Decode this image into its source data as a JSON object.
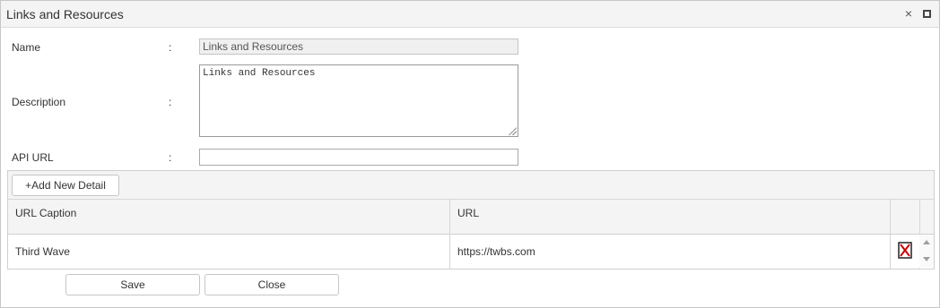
{
  "window": {
    "title": "Links and Resources",
    "close_glyph": "×"
  },
  "form": {
    "name_label": "Name",
    "name_value": "Links and Resources",
    "description_label": "Description",
    "description_value": "Links and Resources",
    "api_url_label": "API URL",
    "api_url_value": "",
    "colon": ":"
  },
  "grid": {
    "add_button_label": "+Add New Detail",
    "columns": [
      "URL Caption",
      "URL"
    ],
    "rows": [
      {
        "caption": "Third Wave",
        "url": "https://twbs.com",
        "delete_icon": "delete-icon"
      }
    ]
  },
  "footer": {
    "save_label": "Save",
    "close_label": "Close"
  },
  "colors": {
    "delete_icon": "#cc0000",
    "header_bg": "#f4f4f4"
  }
}
